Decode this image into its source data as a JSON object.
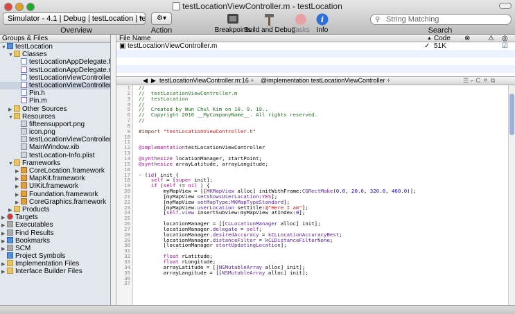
{
  "window": {
    "title": "testLocationViewController.m - testLocation"
  },
  "toolbar": {
    "overview_value": "Simulator - 4.1 | Debug | testLocation | tes...",
    "overview_label": "Overview",
    "action_label": "Action",
    "breakpoints_label": "Breakpoints",
    "build_debug_label": "Build and Debug",
    "tasks_label": "Tasks",
    "info_label": "Info",
    "search_placeholder": "String Matching",
    "search_label": "Search"
  },
  "sidebar": {
    "header": "Groups & Files",
    "items": [
      {
        "label": "testLocation",
        "indent": 0,
        "arrow": "▼",
        "icon": "blue"
      },
      {
        "label": "Classes",
        "indent": 1,
        "arrow": "▼",
        "icon": "folder"
      },
      {
        "label": "testLocationAppDelegate.h",
        "indent": 2,
        "arrow": "",
        "icon": "hfile"
      },
      {
        "label": "testLocationAppDelegate.m",
        "indent": 2,
        "arrow": "",
        "icon": "mfile"
      },
      {
        "label": "testLocationViewController.h",
        "indent": 2,
        "arrow": "",
        "icon": "hfile"
      },
      {
        "label": "testLocationViewController.m",
        "indent": 2,
        "arrow": "",
        "icon": "mfile",
        "selected": true
      },
      {
        "label": "Pin.h",
        "indent": 2,
        "arrow": "",
        "icon": "hfile"
      },
      {
        "label": "Pin.m",
        "indent": 2,
        "arrow": "",
        "icon": "mfile"
      },
      {
        "label": "Other Sources",
        "indent": 1,
        "arrow": "▶",
        "icon": "folder"
      },
      {
        "label": "Resources",
        "indent": 1,
        "arrow": "▼",
        "icon": "folder"
      },
      {
        "label": "fifteensupport.png",
        "indent": 2,
        "arrow": "",
        "icon": "png"
      },
      {
        "label": "icon.png",
        "indent": 2,
        "arrow": "",
        "icon": "png"
      },
      {
        "label": "testLocationViewController.xib",
        "indent": 2,
        "arrow": "",
        "icon": "png"
      },
      {
        "label": "MainWindow.xib",
        "indent": 2,
        "arrow": "",
        "icon": "png"
      },
      {
        "label": "testLocation-Info.plist",
        "indent": 2,
        "arrow": "",
        "icon": "png"
      },
      {
        "label": "Frameworks",
        "indent": 1,
        "arrow": "▼",
        "icon": "folder"
      },
      {
        "label": "CoreLocation.framework",
        "indent": 2,
        "arrow": "▶",
        "icon": "fw"
      },
      {
        "label": "MapKit.framework",
        "indent": 2,
        "arrow": "▶",
        "icon": "fw"
      },
      {
        "label": "UIKit.framework",
        "indent": 2,
        "arrow": "▶",
        "icon": "fw"
      },
      {
        "label": "Foundation.framework",
        "indent": 2,
        "arrow": "▶",
        "icon": "fw"
      },
      {
        "label": "CoreGraphics.framework",
        "indent": 2,
        "arrow": "▶",
        "icon": "fw"
      },
      {
        "label": "Products",
        "indent": 1,
        "arrow": "▶",
        "icon": "folder"
      },
      {
        "label": "Targets",
        "indent": 0,
        "arrow": "▶",
        "icon": "target"
      },
      {
        "label": "Executables",
        "indent": 0,
        "arrow": "▶",
        "icon": "gray"
      },
      {
        "label": "Find Results",
        "indent": 0,
        "arrow": "▶",
        "icon": "gray"
      },
      {
        "label": "Bookmarks",
        "indent": 0,
        "arrow": "▶",
        "icon": "blue"
      },
      {
        "label": "SCM",
        "indent": 0,
        "arrow": "▶",
        "icon": "gray"
      },
      {
        "label": "Project Symbols",
        "indent": 0,
        "arrow": "",
        "icon": "blue"
      },
      {
        "label": "Implementation Files",
        "indent": 0,
        "arrow": "▶",
        "icon": "folder"
      },
      {
        "label": "Interface Builder Files",
        "indent": 0,
        "arrow": "▶",
        "icon": "folder"
      }
    ]
  },
  "file_table": {
    "col_filename": "File Name",
    "col_code": "Code",
    "row": {
      "name": "testLocationViewController.m",
      "check": "✓",
      "code": "51K"
    }
  },
  "navbar": {
    "file": "testLocationViewController.m:16 ÷",
    "symbol": "@implementation testLocationViewController ÷"
  },
  "editor": {
    "lines": [
      [
        [
          "cm",
          "//"
        ]
      ],
      [
        [
          "cm",
          "//  testLocationViewController.m"
        ]
      ],
      [
        [
          "cm",
          "//  testLocation"
        ]
      ],
      [
        [
          "cm",
          "//"
        ]
      ],
      [
        [
          "cm",
          "//  Created by Wun Chul Kim on 10. 9. 19.."
        ]
      ],
      [
        [
          "cm",
          "//  Copyright 2010 __MyCompanyName__. All rights reserved."
        ]
      ],
      [
        [
          "cm",
          "//"
        ]
      ],
      [],
      [
        [
          "pp",
          "#import "
        ],
        [
          "str",
          "\"testLocationViewController.h\""
        ]
      ],
      [],
      [],
      [
        [
          "kw",
          "@implementation"
        ],
        [
          "",
          "testLocationViewController"
        ]
      ],
      [],
      [
        [
          "kw",
          "@synthesize"
        ],
        [
          "",
          " locationManager, startPoint;"
        ]
      ],
      [
        [
          "kw",
          "@synthesize"
        ],
        [
          "",
          " arrayLatitude, arrayLangitude;"
        ]
      ],
      [],
      [
        [
          "",
          "- ("
        ],
        [
          "kw",
          "id"
        ],
        [
          "",
          ") init {"
        ]
      ],
      [
        [
          "",
          "    "
        ],
        [
          "kw",
          "self"
        ],
        [
          "",
          " = ["
        ],
        [
          "kw",
          "super"
        ],
        [
          "",
          " init];"
        ]
      ],
      [
        [
          "",
          "    "
        ],
        [
          "kw",
          "if"
        ],
        [
          "",
          " ("
        ],
        [
          "kw",
          "self"
        ],
        [
          "",
          " != "
        ],
        [
          "kw",
          "nil"
        ],
        [
          "",
          " ) {"
        ]
      ],
      [
        [
          "",
          "        myMapView = [["
        ],
        [
          "cls",
          "MKMapView"
        ],
        [
          "",
          " alloc] initWithFrame:"
        ],
        [
          "cls",
          "CGRectMake"
        ],
        [
          "",
          "("
        ],
        [
          "num",
          "0.0"
        ],
        [
          "",
          ", "
        ],
        [
          "num",
          "20.0"
        ],
        [
          "",
          ", "
        ],
        [
          "num",
          "320.0"
        ],
        [
          "",
          ", "
        ],
        [
          "num",
          "460.0"
        ],
        [
          "",
          ")];"
        ]
      ],
      [
        [
          "",
          "        [myMapView "
        ],
        [
          "cls",
          "setShowsUserLocation"
        ],
        [
          "",
          ":"
        ],
        [
          "kw",
          "YES"
        ],
        [
          "",
          "];"
        ]
      ],
      [
        [
          "",
          "        [myMapView "
        ],
        [
          "cls",
          "setMapType"
        ],
        [
          "",
          ":"
        ],
        [
          "cls",
          "MKMapTypeStandard"
        ],
        [
          "",
          "];"
        ]
      ],
      [
        [
          "",
          "        [myMapView."
        ],
        [
          "cls",
          "userLocation"
        ],
        [
          "",
          " setTitle:"
        ],
        [
          "str",
          "@\"Here I am\""
        ],
        [
          "",
          "];"
        ]
      ],
      [
        [
          "",
          "        ["
        ],
        [
          "kw",
          "self"
        ],
        [
          "",
          "."
        ],
        [
          "cls",
          "view"
        ],
        [
          "",
          " insertSubview:myMapView atIndex:"
        ],
        [
          "num",
          "0"
        ],
        [
          "",
          "];"
        ]
      ],
      [],
      [
        [
          "",
          "        locationManager = [["
        ],
        [
          "cls",
          "CLLocationManager"
        ],
        [
          "",
          " alloc] init];"
        ]
      ],
      [
        [
          "",
          "        locationManager."
        ],
        [
          "cls",
          "delegate"
        ],
        [
          "",
          " = "
        ],
        [
          "kw",
          "self"
        ],
        [
          "",
          ";"
        ]
      ],
      [
        [
          "",
          "        locationManager."
        ],
        [
          "cls",
          "desiredAccuracy"
        ],
        [
          "",
          " = "
        ],
        [
          "cls",
          "kCLLocationAccuracyBest"
        ],
        [
          "",
          ";"
        ]
      ],
      [
        [
          "",
          "        locationManager."
        ],
        [
          "cls",
          "distanceFilter"
        ],
        [
          "",
          " = "
        ],
        [
          "cls",
          "kCLDistanceFilterNone"
        ],
        [
          "",
          ";"
        ]
      ],
      [
        [
          "",
          "        [locationManager "
        ],
        [
          "cls",
          "startUpdatingLocation"
        ],
        [
          "",
          "];"
        ]
      ],
      [],
      [
        [
          "",
          "        "
        ],
        [
          "kw",
          "float"
        ],
        [
          "",
          " rLatitude;"
        ]
      ],
      [
        [
          "",
          "        "
        ],
        [
          "kw",
          "float"
        ],
        [
          "",
          " rLongitude;"
        ]
      ],
      [
        [
          "",
          "        arrayLatitude = [["
        ],
        [
          "cls",
          "NSMutableArray"
        ],
        [
          "",
          " alloc] init];"
        ]
      ],
      [
        [
          "",
          "        arrayLangitude = [["
        ],
        [
          "cls",
          "NSMutableArray"
        ],
        [
          "",
          " alloc] init];"
        ]
      ],
      [],
      []
    ]
  }
}
